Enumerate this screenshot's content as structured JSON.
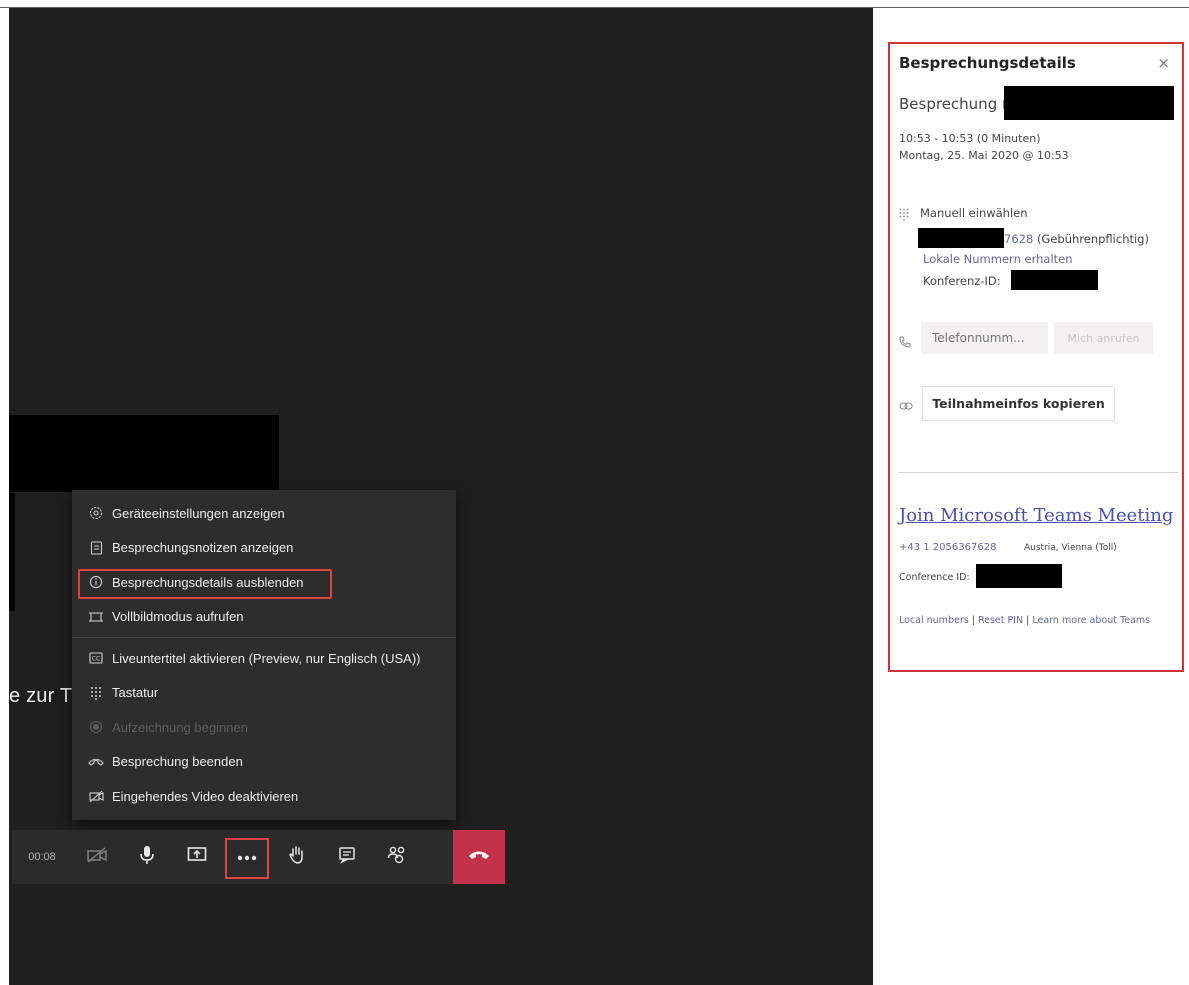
{
  "stage": {
    "caption": "e zur T"
  },
  "menu": {
    "items": [
      {
        "label": "Geräteeinstellungen anzeigen",
        "icon": "gear-icon"
      },
      {
        "label": "Besprechungsnotizen anzeigen",
        "icon": "notes-icon"
      },
      {
        "label": "Besprechungsdetails ausblenden",
        "icon": "info-icon"
      },
      {
        "label": "Vollbildmodus aufrufen",
        "icon": "fullscreen-icon"
      },
      {
        "label": "Liveuntertitel aktivieren (Preview, nur Englisch (USA))",
        "icon": "captions-icon"
      },
      {
        "label": "Tastatur",
        "icon": "dialpad-icon"
      },
      {
        "label": "Aufzeichnung beginnen",
        "icon": "record-icon"
      },
      {
        "label": "Besprechung beenden",
        "icon": "hangup-icon"
      },
      {
        "label": "Eingehendes Video deaktivieren",
        "icon": "video-off-icon"
      }
    ]
  },
  "callbar": {
    "timer": "00:08",
    "buttons": [
      "camera-off-icon",
      "microphone-icon",
      "share-screen-icon",
      "more-actions-icon",
      "raise-hand-icon",
      "chat-icon",
      "participants-icon",
      "hangup-icon"
    ]
  },
  "panel": {
    "title": "Besprechungsdetails",
    "close": "×",
    "meeting_with": "Besprechung mit",
    "time_range": "10:53 - 10:53 (0 Minuten)",
    "date": "Montag, 25. Mai 2020 @ 10:53",
    "dial_in_label": "Manuell einwählen",
    "phone_suffix": "7628",
    "phone_note": "(Gebührenpflichtig)",
    "local_numbers_link": "Lokale Nummern erhalten",
    "conference_id_label": "Konferenz-ID:",
    "phone_placeholder": "Telefonnumm...",
    "call_me_button": "Mich anrufen",
    "copy_button": "Teilnahmeinfos kopieren",
    "join_link": "Join Microsoft Teams Meeting",
    "join_phone": "+43 1 2056367628",
    "join_region": "Austria, Vienna (Toll)",
    "join_conference_label": "Conference ID:",
    "footer": {
      "local_numbers": "Local numbers",
      "separator": "|",
      "reset_pin": "Reset PIN",
      "learn_more": "Learn more about Teams"
    }
  },
  "colors": {
    "stage": "#1f1f1f",
    "menu": "#2d2d2d",
    "highlight_border": "#e0443e",
    "hangup": "#c4314b",
    "link": "#6264a7"
  }
}
